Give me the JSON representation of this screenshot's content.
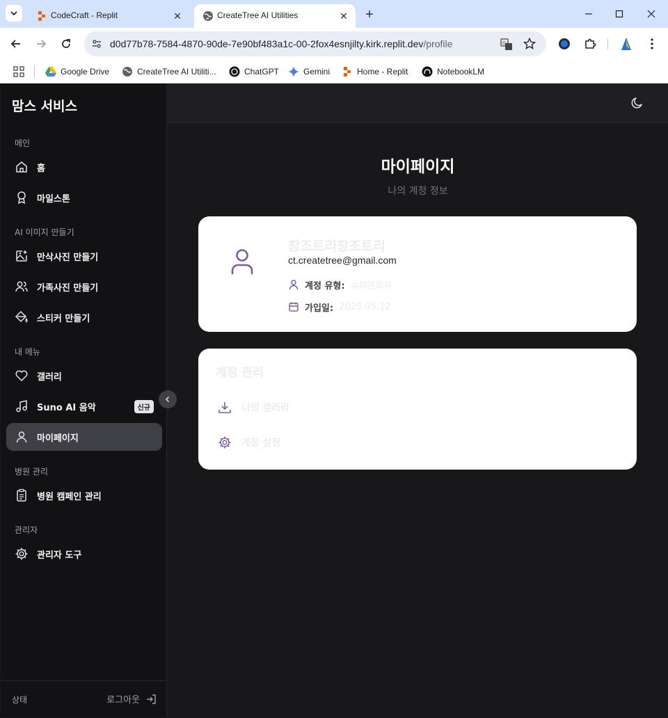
{
  "browser": {
    "tabs": [
      {
        "title": "CodeCraft - Replit"
      },
      {
        "title": "CreateTree AI Utilities"
      }
    ],
    "url_main": "d0d77b78-7584-4870-90de-7e90bf483a1c-00-2fox4esnjilty.kirk.replit.dev",
    "url_path": "/profile",
    "bookmarks": [
      {
        "label": "Google Drive",
        "icon": "google-drive-icon"
      },
      {
        "label": "CreateTree AI Utiliti...",
        "icon": "globe-icon"
      },
      {
        "label": "ChatGPT",
        "icon": "chatgpt-icon"
      },
      {
        "label": "Gemini",
        "icon": "gemini-icon"
      },
      {
        "label": "Home - Replit",
        "icon": "replit-icon"
      },
      {
        "label": "NotebookLM",
        "icon": "notebooklm-icon"
      }
    ]
  },
  "sidebar": {
    "brand": "맘스 서비스",
    "sections": {
      "main": "메인",
      "ai": "AI 이미지 만들기",
      "menu": "내 메뉴",
      "hospital": "병원 관리",
      "admin": "관리자"
    },
    "items": {
      "home": "홈",
      "milestone": "마일스톤",
      "maternity": "만삭사진 만들기",
      "family": "가족사진 만들기",
      "sticker": "스티커 만들기",
      "gallery": "갤러리",
      "suno": "Suno AI 음악",
      "suno_badge": "신규",
      "mypage": "마이페이지",
      "campaign": "병원 캠페인 관리",
      "admin_tools": "관리자 도구"
    },
    "footer": {
      "status": "상태",
      "logout": "로그아웃"
    }
  },
  "page": {
    "title": "마이페이지",
    "subtitle": "나의 계정 정보"
  },
  "profile": {
    "name": "창조트리창조트리",
    "email": "ct.createtree@gmail.com",
    "account_type_label": "계정 유형:",
    "account_type_value": "슈퍼관리자",
    "joined_label": "가입일:",
    "joined_value": "2025.05.12."
  },
  "account": {
    "title": "계정 관리",
    "my_gallery": "나의 갤러리",
    "settings": "계정 설정"
  },
  "colors": {
    "accent": "#7c5ca6",
    "sidebar_bg": "#121214",
    "main_bg": "#18181b",
    "active_item": "#3f3f46"
  }
}
